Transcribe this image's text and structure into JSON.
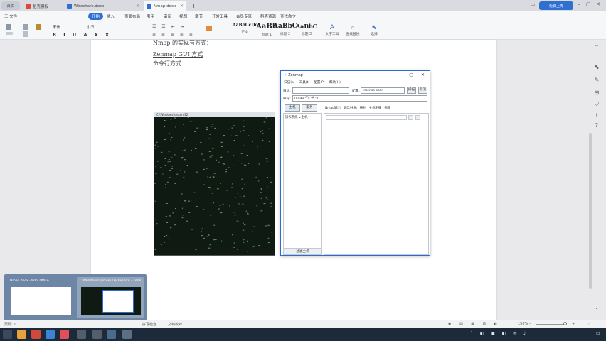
{
  "tabs": {
    "home": "首页",
    "tab1": "稻壳模板",
    "tab2": "Wireshark.docx",
    "tab3": "Nmap.docx",
    "add": "+"
  },
  "window": {
    "login": "免费上传"
  },
  "menubar": {
    "file": "三 文件",
    "start": "开始",
    "insert": "插入",
    "page_layout": "页面布局",
    "reference": "引用",
    "review": "审阅",
    "view": "视图",
    "section": "章节",
    "dev_tools": "开发工具",
    "member": "会员专享",
    "docer": "稻壳资源",
    "search": "查找命令"
  },
  "ribbon": {
    "font_name": "宋体",
    "font_size": "小五",
    "styles": [
      {
        "preview": "AaBbCcDd",
        "label": "正文"
      },
      {
        "preview": "AaBb",
        "label": "标题 1"
      },
      {
        "preview": "AaBbC",
        "label": "标题 2"
      },
      {
        "preview": "AaBbC",
        "label": "标题 3"
      }
    ],
    "text_tools": "文字工具",
    "find_replace": "查找替换",
    "select": "选择"
  },
  "document": {
    "line1": "Nmap 的实现有方式：",
    "line2": "Zenmap GUI 方式",
    "line3": "命令行方式"
  },
  "terminal": {
    "title": "C:\\Windows\\system32"
  },
  "zenmap": {
    "title": "Zenmap",
    "menu": [
      "扫描(a)",
      "工具(t)",
      "配置(P)",
      "帮助(H)"
    ],
    "target_label": "目标:",
    "target_value": "",
    "profile_label": "配置:",
    "profile_value": "Intense scan",
    "scan_button": "扫描",
    "cancel_button": "取消",
    "command_label": "命令:",
    "command_value": "nmap -T4 -A -v",
    "left_tabs": [
      "主机",
      "服务"
    ],
    "left_header": "操作系统 ◂ 主机",
    "right_tabs": [
      "Nmap输出",
      "端口/主机",
      "拓扑",
      "主机明细",
      "扫描"
    ],
    "filter_button": "过滤主机"
  },
  "preview": {
    "item1_title": "Nmap.docx - WPS Office",
    "item2_title": "C:\\Windows\\system32\\cmd.exe - Zenmap"
  },
  "statusbar": {
    "page": "页码: 1",
    "spellcheck": "拼写检查",
    "doc_proof": "文档校对",
    "zoom": "150%"
  },
  "colors": {
    "accent": "#2f6fd1",
    "terminal_bg": "#0f1a12",
    "taskbar_bg": "#1c2a3a"
  }
}
